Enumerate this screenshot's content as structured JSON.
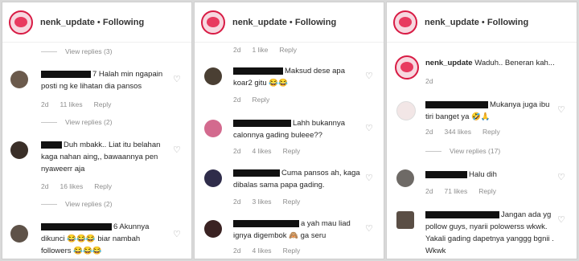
{
  "header": {
    "username": "nenk_update",
    "separator": "•",
    "follow": "Following"
  },
  "labels": {
    "reply": "Reply",
    "view_replies_1": "View replies (3)",
    "view_replies_2": "View replies (2)",
    "view_replies_3": "View replies (2)",
    "view_replies_4": "View replies (17)"
  },
  "panel1": {
    "c1": {
      "text": "7 Halah min ngapain posti ng ke lihatan dia pansos",
      "time": "2d",
      "likes": "11 likes"
    },
    "c2": {
      "text": "Duh mbakk.. Liat itu belahan kaga nahan aing,, bawaannya pen nyaweerr aja",
      "time": "2d",
      "likes": "16 likes"
    },
    "c3": {
      "text": "6 Akunnya dikunci 😂😂😂 biar nambah followers 😂😂😂"
    }
  },
  "panel2": {
    "top": {
      "time": "2d",
      "likes": "1 like"
    },
    "c1": {
      "text": "Maksud dese apa koar2 gitu 😂😂",
      "time": "2d"
    },
    "c2": {
      "text": "Lahh bukannya calonnya gading buleee??",
      "time": "2d",
      "likes": "4 likes"
    },
    "c3": {
      "text": "Cuma pansos ah, kaga dibalas sama papa gading.",
      "time": "2d",
      "likes": "3 likes"
    },
    "c4": {
      "text": "a yah mau liad ignya digembok 🙈 ga seru",
      "time": "2d",
      "likes": "4 likes"
    }
  },
  "panel3": {
    "caption": {
      "text": "Waduh.. Beneran kah...",
      "time": "2d"
    },
    "c1": {
      "text": "Mukanya juga ibu tiri banget ya 🤣🙏",
      "time": "2d",
      "likes": "344 likes"
    },
    "c2": {
      "text": "Halu dih",
      "time": "2d",
      "likes": "71 likes"
    },
    "c3": {
      "text": "Jangan ada yg pollow guys, nyarii polowerss wkwk. Yakali gading dapetnya yanggg bgnii . Wkwk"
    }
  }
}
